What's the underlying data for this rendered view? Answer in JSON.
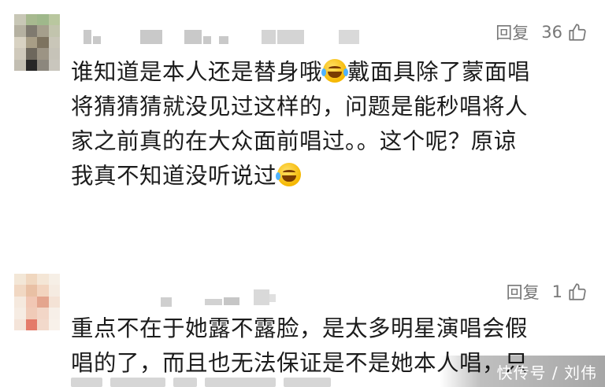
{
  "comments": [
    {
      "reply_label": "回复",
      "like_count": "36",
      "lines": [
        "谁知道是本人还是替身哦",
        "戴面具除了蒙面唱",
        "将猜猜猜就没见过这样的，问题是能秒唱将人",
        "家之前真的在大众面前唱过。。这个呢？原谅",
        "我真不知道没听说过"
      ]
    },
    {
      "reply_label": "回复",
      "like_count": "1",
      "lines": [
        "重点不在于她露不露脸，是太多明星演唱会假",
        "唱的了，而且也无法保证是不是她本人唱，只"
      ]
    }
  ],
  "watermark": "快传号 / 刘伟",
  "icons": {
    "like": "thumbs-up-icon",
    "emoji_laugh": "laughing-tears-emoji",
    "emoji_cry": "crying-emoji"
  },
  "colors": {
    "action_gray": "#777777",
    "text": "#1c1c1c"
  }
}
